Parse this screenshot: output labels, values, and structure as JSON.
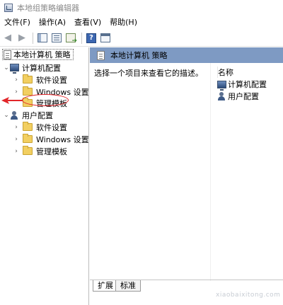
{
  "window": {
    "title": "本地组策略编辑器"
  },
  "menu": [
    "文件(F)",
    "操作(A)",
    "查看(V)",
    "帮助(H)"
  ],
  "toolbar": {
    "icons": [
      "back-arrow-icon",
      "forward-arrow-icon",
      "show-hide-tree-icon",
      "list-view-icon",
      "export-list-icon",
      "help-icon",
      "properties-icon"
    ],
    "help_glyph": "?"
  },
  "tree": {
    "root": "本地计算机 策略",
    "computer_config": "计算机配置",
    "computer_children": [
      "软件设置",
      "Windows 设置",
      "管理模板"
    ],
    "user_config": "用户配置",
    "user_children": [
      "软件设置",
      "Windows 设置",
      "管理模板"
    ]
  },
  "right": {
    "header": "本地计算机 策略",
    "description": "选择一个项目来查看它的描述。",
    "column_name": "名称",
    "items": [
      "计算机配置",
      "用户配置"
    ]
  },
  "tabs": [
    "扩展",
    "标准"
  ],
  "annotation": {
    "color": "#e2262a",
    "highlighted_item": "管理模板"
  },
  "watermark": "xiaobaixitong.com"
}
